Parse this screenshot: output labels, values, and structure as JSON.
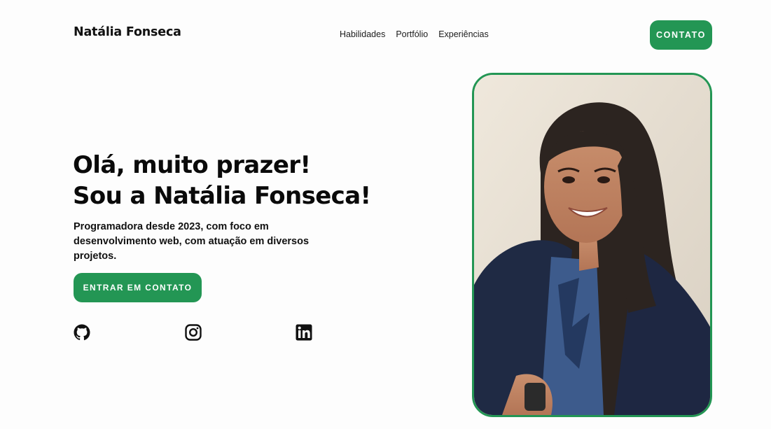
{
  "header": {
    "brand": "Natália Fonseca",
    "nav": [
      {
        "label": "Habilidades"
      },
      {
        "label": "Portfólio"
      },
      {
        "label": "Experiências"
      }
    ],
    "contact_button": "CONTATO"
  },
  "hero": {
    "title_line1": "Olá, muito prazer!",
    "title_line2": "Sou a Natália Fonseca!",
    "description": "Programadora desde 2023, com foco em desenvolvimento web, com atuação em diversos projetos.",
    "cta_button": "ENTRAR EM CONTATO",
    "social_icons": [
      "github-icon",
      "instagram-icon",
      "linkedin-icon"
    ]
  },
  "colors": {
    "accent": "#239654",
    "text": "#0b0b0b",
    "background": "#fdfdfd"
  }
}
